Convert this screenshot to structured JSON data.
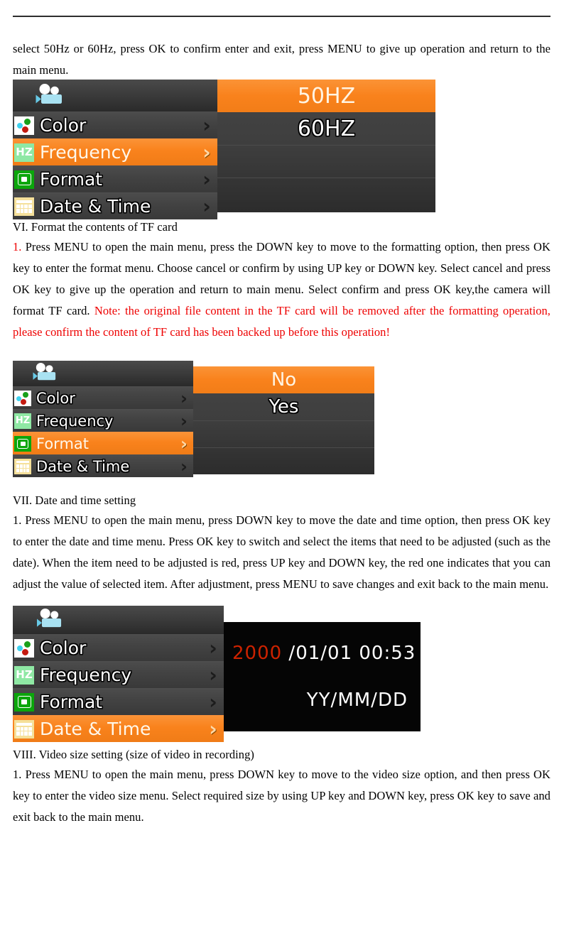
{
  "document": {
    "paragraphs": [
      {
        "id": "p-intro",
        "text": "select 50Hz or 60Hz, press OK to confirm enter and exit, press MENU to give up operation and return to the main menu."
      },
      {
        "id": "p-heading-vi",
        "text": "VI. Format the contents of TF card"
      },
      {
        "id": "p-vi-black-1",
        "text": "1."
      },
      {
        "id": "p-vi-body",
        "text": " Press MENU to open the main menu, press the DOWN key to move to the formatting option, then press OK key to enter the format menu. Choose cancel or confirm by using UP key or DOWN key. Select cancel and press OK key to give up the operation and return to main menu. Select confirm and press OK key,the camera will format TF card. "
      },
      {
        "id": "p-vi-note",
        "text": "Note: the original file content in the TF card will be removed after the formatting operation, please confirm the content of TF card has been backed up before this operation!"
      },
      {
        "id": "p-heading-vii",
        "text": "VII. Date and time setting"
      },
      {
        "id": "p-vii-body",
        "text": "1. Press MENU to open the main menu, press DOWN key to move the date and time option, then press OK key to enter the date and time menu. Press OK key to switch and select the items that need to be adjusted (such as the date). When the item need to be adjusted is red, press UP key and DOWN key, the red one indicates that you can adjust the value of selected item. After adjustment, press MENU to save changes and exit back to the main menu."
      },
      {
        "id": "p-heading-viii",
        "text": "VIII. Video size setting (size of video in recording)"
      },
      {
        "id": "p-viii-body",
        "text": "1. Press MENU to open the main menu, press DOWN key to move to the video size option, and then press OK key to enter the video size menu. Select required size by using UP key and DOWN key, press OK key to save and exit back to the main menu."
      }
    ]
  },
  "colors": {
    "accent_orange": "#f9821c",
    "menu_dark": "#3e3e3e",
    "note_red": "#ee0000",
    "date_year_red": "#cc2200",
    "icon_color_bg": "#ffffff",
    "icon_hz_bg": "#8fe8a4",
    "icon_format_bg": "#0ba60b",
    "icon_date_bg": "#f5e09a",
    "camera_icon": "#a9e2f2"
  },
  "menus": {
    "frequency": {
      "header_icon": "video-camera-icon",
      "items": [
        {
          "label": "Color",
          "icon": "color-palette-icon",
          "arrow": "›",
          "selected": false
        },
        {
          "label": "Frequency",
          "icon": "hz-icon",
          "arrow": "›",
          "selected": true
        },
        {
          "label": "Format",
          "icon": "format-icon",
          "arrow": "›",
          "selected": false
        },
        {
          "label": "Date & Time",
          "icon": "calendar-icon",
          "arrow": "›",
          "selected": false
        }
      ],
      "options": [
        {
          "label": "50HZ",
          "selected": true
        },
        {
          "label": "60HZ",
          "selected": false
        }
      ]
    },
    "format": {
      "header_icon": "video-camera-icon",
      "items": [
        {
          "label": "Color",
          "icon": "color-palette-icon",
          "arrow": "›",
          "selected": false
        },
        {
          "label": "Frequency",
          "icon": "hz-icon",
          "arrow": "›",
          "selected": false
        },
        {
          "label": "Format",
          "icon": "format-icon",
          "arrow": "›",
          "selected": true
        },
        {
          "label": "Date & Time",
          "icon": "calendar-icon",
          "arrow": "›",
          "selected": false
        }
      ],
      "options": [
        {
          "label": "No",
          "selected": true
        },
        {
          "label": "Yes",
          "selected": false
        }
      ]
    },
    "datetime": {
      "header_icon": "video-camera-icon",
      "items": [
        {
          "label": "Color",
          "icon": "color-palette-icon",
          "arrow": "›",
          "selected": false
        },
        {
          "label": "Frequency",
          "icon": "hz-icon",
          "arrow": "›",
          "selected": false
        },
        {
          "label": "Format",
          "icon": "format-icon",
          "arrow": "›",
          "selected": false
        },
        {
          "label": "Date & Time",
          "icon": "calendar-icon",
          "arrow": "›",
          "selected": true
        }
      ],
      "display": {
        "year": "2000",
        "rest": " /01/01 00:53",
        "format_label": "YY/MM/DD"
      }
    }
  },
  "icon_labels": {
    "hz": "HZ"
  }
}
